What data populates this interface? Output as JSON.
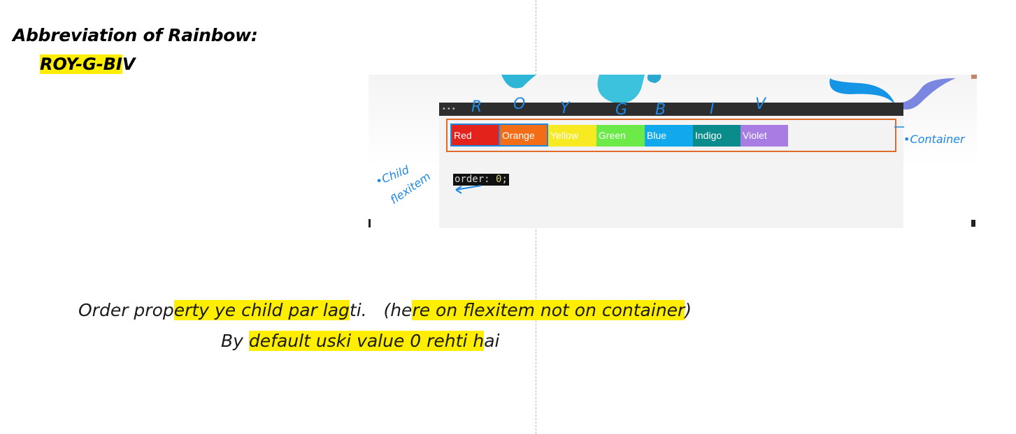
{
  "heading": "Abbreviation of Rainbow:",
  "abbreviation": {
    "highlighted": "ROY-G-BI",
    "rest": "V"
  },
  "demo": {
    "dots": "•••",
    "handwritten_letters": [
      "R",
      "O",
      "Y",
      "G",
      "B",
      "I",
      "V"
    ],
    "items": [
      {
        "label": "Red",
        "color": "#e4221c",
        "text_color": "#ffffff"
      },
      {
        "label": "Orange",
        "color": "#f26d16",
        "text_color": "#ffffff"
      },
      {
        "label": "Yellow",
        "color": "#f7e922",
        "text_color": "#ffffff"
      },
      {
        "label": "Green",
        "color": "#6bea48",
        "text_color": "#ffffff"
      },
      {
        "label": "Blue",
        "color": "#12a9ec",
        "text_color": "#ffffff"
      },
      {
        "label": "Indigo",
        "color": "#0a8c8d",
        "text_color": "#ffffff"
      },
      {
        "label": "Violet",
        "color": "#a77ce3",
        "text_color": "#ffffff"
      }
    ],
    "code": {
      "property": "order:",
      "value": "0",
      "semicolon": ";"
    },
    "container_border_color": "#e06a2a",
    "annotation_color": "#1e88e5",
    "label_container": "•Container",
    "label_child": [
      "•Child",
      "flexitem"
    ]
  },
  "notes": {
    "line1": [
      {
        "t": "Order prop",
        "hl": false
      },
      {
        "t": "erty ye child par lag",
        "hl": true
      },
      {
        "t": "ti.   (he",
        "hl": false
      },
      {
        "t": "re on flexitem not on container",
        "hl": true
      },
      {
        "t": ")",
        "hl": false
      }
    ],
    "line2": [
      {
        "t": "By ",
        "hl": false
      },
      {
        "t": "default usk",
        "hl": true
      },
      {
        "t": "i value 0 rehti h",
        "hl": true
      },
      {
        "t": "ai",
        "hl": false
      }
    ]
  },
  "highlight_color": "#ffee00"
}
